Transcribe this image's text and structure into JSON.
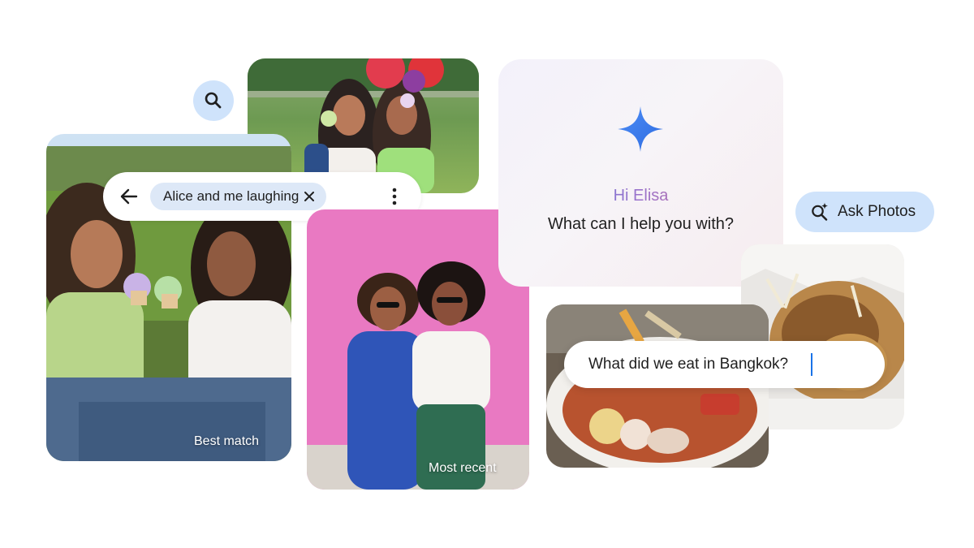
{
  "search_bar": {
    "query_chip": "Alice and me laughing"
  },
  "photos": {
    "best_match_label": "Best match",
    "most_recent_label": "Most recent"
  },
  "assistant": {
    "greeting": "Hi Elisa",
    "prompt": "What can I help you with?"
  },
  "ask_photos_button": {
    "label": "Ask Photos"
  },
  "query_input": {
    "value": "What did we eat in Bangkok?"
  },
  "icons": {
    "search": "search-icon",
    "back": "arrow-back-icon",
    "clear": "close-icon",
    "more": "more-vert-icon",
    "sparkle": "gemini-sparkle-icon",
    "ask_photos": "search-sparkle-icon"
  }
}
